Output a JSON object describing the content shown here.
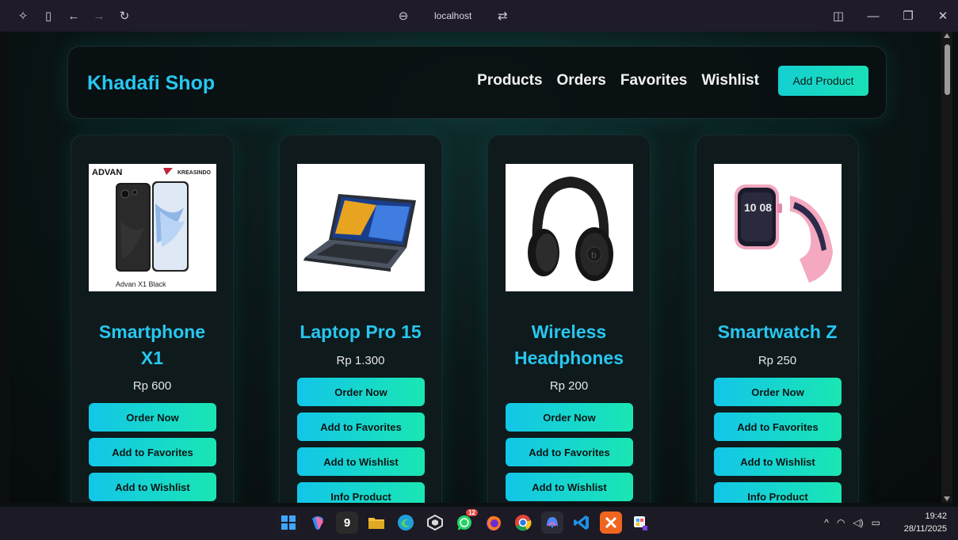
{
  "browser": {
    "address": "localhost",
    "icons": [
      "copilot-icon",
      "sidebar-icon",
      "back-icon",
      "forward-icon",
      "refresh-icon"
    ]
  },
  "navbar": {
    "brand": "Khadafi Shop",
    "links": [
      "Products",
      "Orders",
      "Favorites",
      "Wishlist"
    ],
    "add_product": "Add Product"
  },
  "products": [
    {
      "title": "Smartphone X1",
      "price": "Rp 600",
      "brand_left": "ADVAN",
      "brand_right": "KREASINDO",
      "caption": "Advan X1 Black",
      "buttons": [
        "Order Now",
        "Add to Favorites",
        "Add to Wishlist"
      ]
    },
    {
      "title": "Laptop Pro 15",
      "price": "Rp 1.300",
      "buttons": [
        "Order Now",
        "Add to Favorites",
        "Add to Wishlist",
        "Info Product"
      ]
    },
    {
      "title": "Wireless Headphones",
      "price": "Rp 200",
      "buttons": [
        "Order Now",
        "Add to Favorites",
        "Add to Wishlist"
      ]
    },
    {
      "title": "Smartwatch Z",
      "price": "Rp 250",
      "watch_time": "10 08",
      "buttons": [
        "Order Now",
        "Add to Favorites",
        "Add to Wishlist",
        "Info Product"
      ]
    }
  ],
  "taskbar": {
    "whatsapp_badge": "12",
    "app_9": "9",
    "time": "19:42",
    "date": "28/11/2025"
  },
  "colors": {
    "accent": "#27c7f0",
    "button_start": "#12c6e8",
    "button_end": "#1ae6b3"
  }
}
